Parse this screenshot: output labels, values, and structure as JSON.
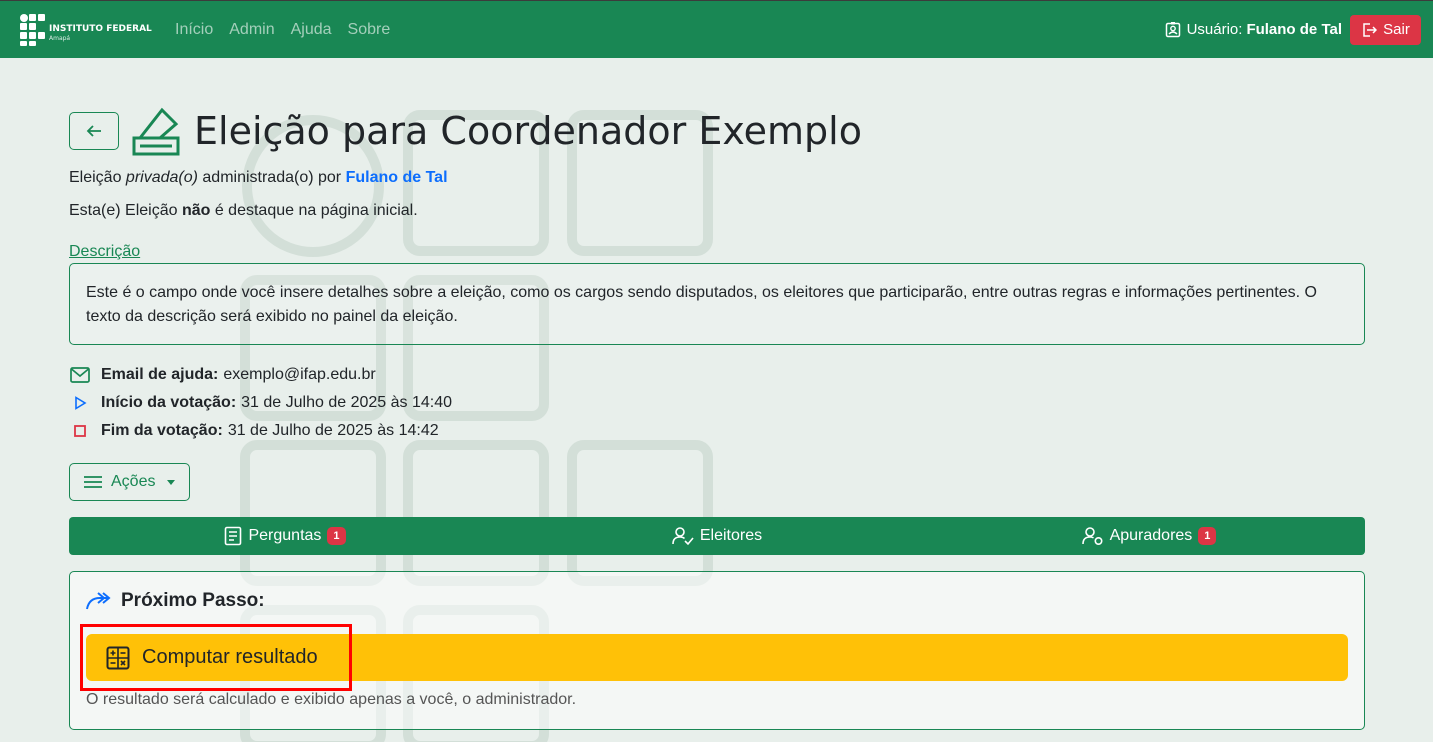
{
  "navbar": {
    "brand_name": "INSTITUTO FEDERAL",
    "brand_sub": "Amapá",
    "links": [
      "Início",
      "Admin",
      "Ajuda",
      "Sobre"
    ],
    "user_prefix": "Usuário:",
    "user_name": "Fulano de Tal",
    "logout_label": "Sair"
  },
  "page": {
    "title": "Eleição para Coordenador Exemplo",
    "visibility_prefix": "Eleição ",
    "visibility_value": "privada(o)",
    "admin_text": " administrada(o) por ",
    "owner": "Fulano de Tal",
    "highlight_prefix": "Esta(e) Eleição ",
    "highlight_bold": "não",
    "highlight_suffix": " é destaque na página inicial.",
    "description_link": "Descrição",
    "description_text": "Este é o campo onde você insere detalhes sobre a eleição, como os cargos sendo disputados, os eleitores que participarão, entre outras regras e informações pertinentes. O texto da descrição será exibido no painel da eleição."
  },
  "meta": {
    "email_label": "Email de ajuda:",
    "email_value": "exemplo@ifap.edu.br",
    "start_label": "Início da votação:",
    "start_value": "31 de Julho de 2025 às 14:40",
    "end_label": "Fim da votação:",
    "end_value": "31 de Julho de 2025 às 14:42"
  },
  "actions_label": "Ações",
  "tabs": [
    {
      "label": "Perguntas",
      "badge": "1"
    },
    {
      "label": "Eleitores",
      "badge": ""
    },
    {
      "label": "Apuradores",
      "badge": "1"
    }
  ],
  "next_step": {
    "title": "Próximo Passo:",
    "button_label": "Computar resultado",
    "note": "O resultado será calculado e exibido apenas a você, o administrador."
  },
  "colors": {
    "primary": "#198754",
    "danger": "#dc3545",
    "warning": "#ffc107",
    "link": "#0d6efd"
  }
}
